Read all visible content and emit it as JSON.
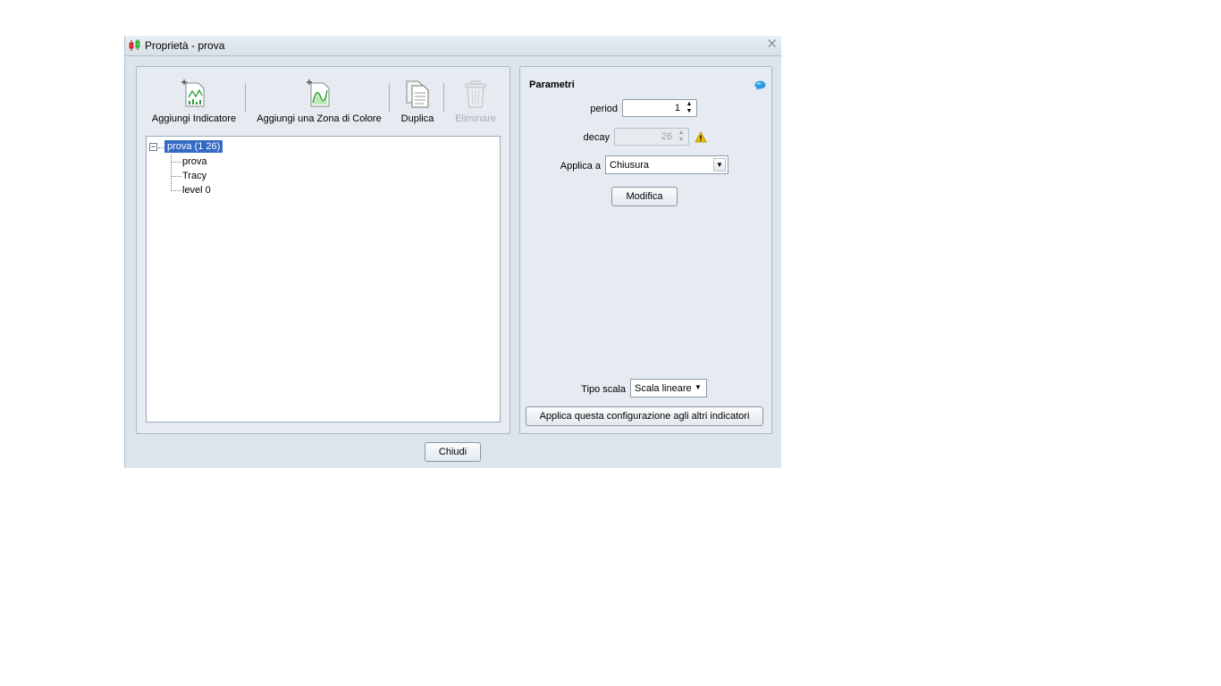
{
  "window": {
    "title": "Proprietà - prova"
  },
  "toolbar": {
    "add_indicator": "Aggiungi Indicatore",
    "add_color_zone": "Aggiungi una Zona di Colore",
    "duplicate": "Duplica",
    "delete": "Eliminare"
  },
  "tree": {
    "root": "prova (1 26)",
    "children": [
      "prova",
      "Tracy",
      "level 0"
    ]
  },
  "params": {
    "title": "Parametri",
    "period_label": "period",
    "period_value": "1",
    "decay_label": "decay",
    "decay_value": "26",
    "apply_to_label": "Applica a",
    "apply_to_value": "Chiusura",
    "modify_button": "Modifica",
    "scale_label": "Tipo scala",
    "scale_value": "Scala lineare",
    "apply_all_button": "Applica questa configurazione agli altri indicatori"
  },
  "footer": {
    "close_button": "Chiudi"
  },
  "colors": {
    "selection": "#3469c4",
    "dialog_bg": "#dce5ec",
    "warning": "#f2c200"
  }
}
